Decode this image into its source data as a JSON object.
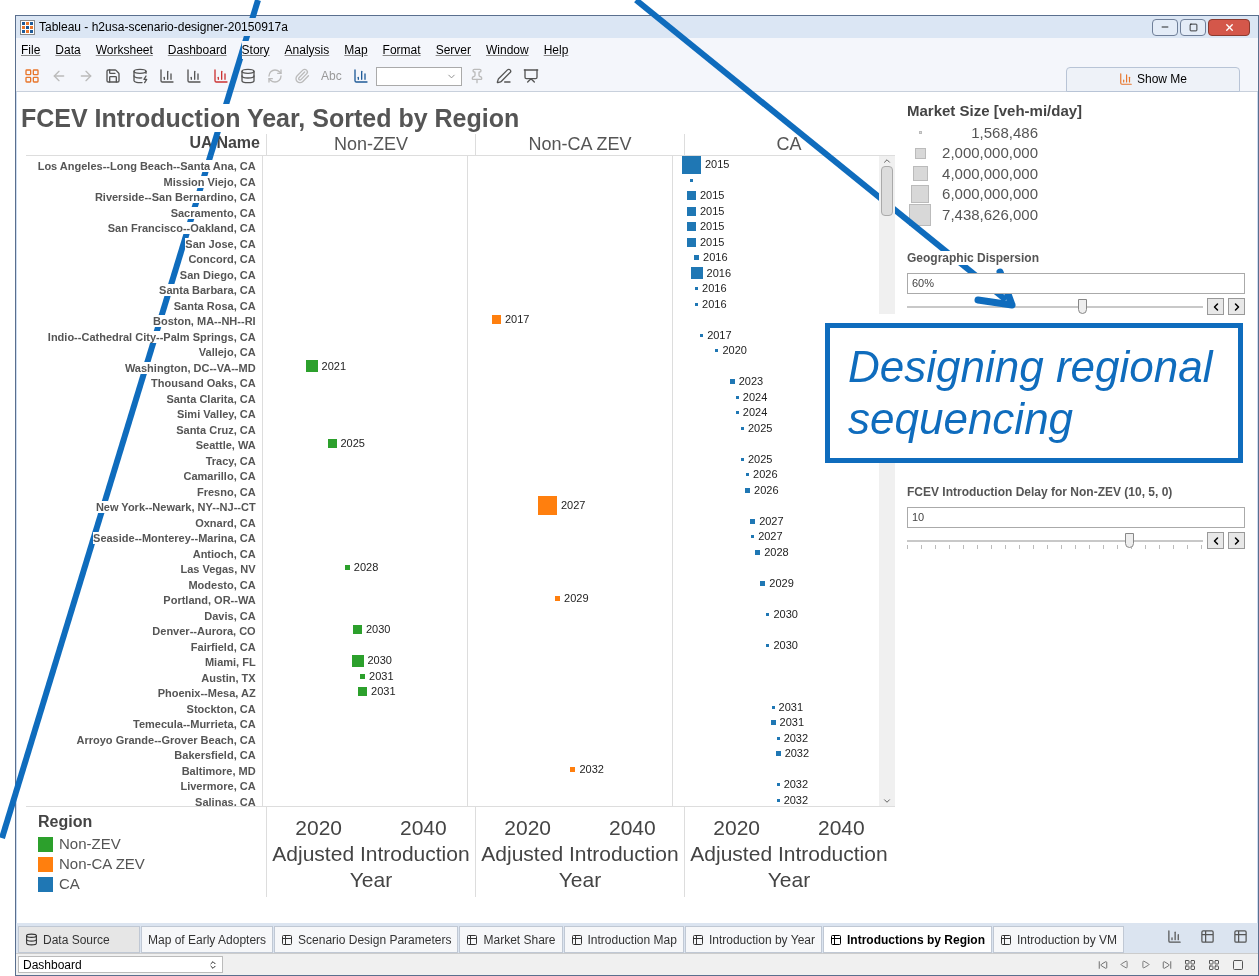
{
  "window": {
    "title": "Tableau - h2usa-scenario-designer-20150917a"
  },
  "menu": [
    "File",
    "Data",
    "Worksheet",
    "Dashboard",
    "Story",
    "Analysis",
    "Map",
    "Format",
    "Server",
    "Window",
    "Help"
  ],
  "toolbar": {
    "text_button": "Abc",
    "show_me": "Show Me"
  },
  "dashboard": {
    "title": "FCEV Introduction Year, Sorted by Region",
    "row_header": "UA Name",
    "panes": [
      {
        "header": "Non-ZEV",
        "ticks": [
          "2020",
          "2040"
        ],
        "axis_title": "Adjusted Introduction Year"
      },
      {
        "header": "Non-CA ZEV",
        "ticks": [
          "2020",
          "2040"
        ],
        "axis_title": "Adjusted Introduction Year"
      },
      {
        "header": "CA",
        "ticks": [
          "2020",
          "2040"
        ],
        "axis_title": "Adjusted Introduction Year"
      }
    ],
    "rows": [
      {
        "name": "Los Angeles--Long Beach--Santa Ana, CA",
        "color": "#1f77b4",
        "year": "2015",
        "kind": "xl"
      },
      {
        "name": "Mission Viejo, CA",
        "color": "#1f77b4",
        "kind": "xs"
      },
      {
        "name": "Riverside--San Bernardino, CA",
        "color": "#1f77b4",
        "year": "2015",
        "kind": "m"
      },
      {
        "name": "Sacramento, CA",
        "color": "#1f77b4",
        "year": "2015",
        "kind": "m"
      },
      {
        "name": "San Francisco--Oakland, CA",
        "color": "#1f77b4",
        "year": "2015",
        "kind": "m"
      },
      {
        "name": "San Jose, CA",
        "color": "#1f77b4",
        "year": "2015",
        "kind": "m"
      },
      {
        "name": "Concord, CA",
        "color": "#1f77b4",
        "year": "2016",
        "kind": "s"
      },
      {
        "name": "San Diego, CA",
        "color": "#1f77b4",
        "year": "2016",
        "kind": "l"
      },
      {
        "name": "Santa Barbara, CA",
        "color": "#1f77b4",
        "year": "2016",
        "kind": "xs"
      },
      {
        "name": "Santa Rosa, CA",
        "color": "#1f77b4",
        "year": "2016",
        "kind": "xs"
      },
      {
        "name": "Boston, MA--NH--RI",
        "color": "#ff7f0e",
        "year": "2017",
        "kind": "m"
      },
      {
        "name": "Indio--Cathedral City--Palm Springs, CA",
        "color": "#1f77b4",
        "year": "2017",
        "kind": "xs"
      },
      {
        "name": "Vallejo, CA",
        "color": "#1f77b4",
        "year": "2020",
        "kind": "xs"
      },
      {
        "name": "Washington, DC--VA--MD",
        "color": "#2ca02c",
        "year": "2021",
        "kind": "l"
      },
      {
        "name": "Thousand Oaks, CA",
        "color": "#1f77b4",
        "year": "2023",
        "kind": "s"
      },
      {
        "name": "Santa Clarita, CA",
        "color": "#1f77b4",
        "year": "2024",
        "kind": "xs"
      },
      {
        "name": "Simi Valley, CA",
        "color": "#1f77b4",
        "year": "2024",
        "kind": "xs"
      },
      {
        "name": "Santa Cruz, CA",
        "color": "#1f77b4",
        "year": "2025",
        "kind": "xs"
      },
      {
        "name": "Seattle, WA",
        "color": "#2ca02c",
        "year": "2025",
        "kind": "m"
      },
      {
        "name": "Tracy, CA",
        "color": "#1f77b4",
        "year": "2025",
        "kind": "xs"
      },
      {
        "name": "Camarillo, CA",
        "color": "#1f77b4",
        "year": "2026",
        "kind": "xs"
      },
      {
        "name": "Fresno, CA",
        "color": "#1f77b4",
        "year": "2026",
        "kind": "s"
      },
      {
        "name": "New York--Newark, NY--NJ--CT",
        "color": "#ff7f0e",
        "year": "2027",
        "kind": "xl"
      },
      {
        "name": "Oxnard, CA",
        "color": "#1f77b4",
        "year": "2027",
        "kind": "s"
      },
      {
        "name": "Seaside--Monterey--Marina, CA",
        "color": "#1f77b4",
        "year": "2027",
        "kind": "xs"
      },
      {
        "name": "Antioch, CA",
        "color": "#1f77b4",
        "year": "2028",
        "kind": "s"
      },
      {
        "name": "Las Vegas, NV",
        "color": "#2ca02c",
        "year": "2028",
        "kind": "s"
      },
      {
        "name": "Modesto, CA",
        "color": "#1f77b4",
        "year": "2029",
        "kind": "s"
      },
      {
        "name": "Portland, OR--WA",
        "color": "#ff7f0e",
        "year": "2029",
        "kind": "s"
      },
      {
        "name": "Davis, CA",
        "color": "#1f77b4",
        "year": "2030",
        "kind": "xs"
      },
      {
        "name": "Denver--Aurora, CO",
        "color": "#2ca02c",
        "year": "2030",
        "kind": "m"
      },
      {
        "name": "Fairfield, CA",
        "color": "#1f77b4",
        "year": "2030",
        "kind": "xs"
      },
      {
        "name": "Miami, FL",
        "color": "#2ca02c",
        "year": "2030",
        "kind": "l"
      },
      {
        "name": "Austin, TX",
        "color": "#2ca02c",
        "year": "2031",
        "kind": "s"
      },
      {
        "name": "Phoenix--Mesa, AZ",
        "color": "#2ca02c",
        "year": "2031",
        "kind": "m"
      },
      {
        "name": "Stockton, CA",
        "color": "#1f77b4",
        "year": "2031",
        "kind": "xs"
      },
      {
        "name": "Temecula--Murrieta, CA",
        "color": "#1f77b4",
        "year": "2031",
        "kind": "s"
      },
      {
        "name": "Arroyo Grande--Grover Beach, CA",
        "color": "#1f77b4",
        "year": "2032",
        "kind": "xs"
      },
      {
        "name": "Bakersfield, CA",
        "color": "#1f77b4",
        "year": "2032",
        "kind": "s"
      },
      {
        "name": "Baltimore, MD",
        "color": "#ff7f0e",
        "year": "2032",
        "kind": "s"
      },
      {
        "name": "Livermore, CA",
        "color": "#1f77b4",
        "year": "2032",
        "kind": "xs"
      },
      {
        "name": "Salinas, CA",
        "color": "#1f77b4",
        "year": "2032",
        "kind": "xs"
      }
    ],
    "region_legend": {
      "title": "Region",
      "items": [
        {
          "label": "Non-ZEV",
          "color": "#2ca02c"
        },
        {
          "label": "Non-CA ZEV",
          "color": "#ff7f0e"
        },
        {
          "label": "CA",
          "color": "#1f77b4"
        }
      ]
    }
  },
  "side_panel": {
    "size_legend": {
      "title": "Market Size [veh-mi/day]",
      "items": [
        {
          "label": "1,568,486",
          "kind": "xs"
        },
        {
          "label": "2,000,000,000",
          "kind": "s"
        },
        {
          "label": "4,000,000,000",
          "kind": "m"
        },
        {
          "label": "6,000,000,000",
          "kind": "l"
        },
        {
          "label": "7,438,626,000",
          "kind": "xl"
        }
      ]
    },
    "parameters": [
      {
        "label": "Geographic Dispersion",
        "value": "60%",
        "level": 0.59,
        "ticks": false
      },
      {
        "label": "FCEV Introduction Delay for Non-ZEV  (10, 5, 0)",
        "value": "10",
        "level": 0.75,
        "ticks": true
      }
    ]
  },
  "sheet_tabs": [
    {
      "label": "Data Source",
      "kind": "source",
      "selected": false
    },
    {
      "label": "Map of Early Adopters",
      "kind": "plain",
      "selected": false
    },
    {
      "label": "Scenario Design Parameters",
      "kind": "sheet",
      "selected": false
    },
    {
      "label": "Market Share",
      "kind": "sheet",
      "selected": false
    },
    {
      "label": "Introduction Map",
      "kind": "sheet",
      "selected": false
    },
    {
      "label": "Introduction by Year",
      "kind": "sheet",
      "selected": false
    },
    {
      "label": "Introductions by Region",
      "kind": "sheet",
      "selected": true
    },
    {
      "label": "Introduction by VM",
      "kind": "sheet",
      "selected": false
    }
  ],
  "status_bar": {
    "view": "Dashboard"
  },
  "callout": {
    "text": "Designing regional sequencing"
  }
}
